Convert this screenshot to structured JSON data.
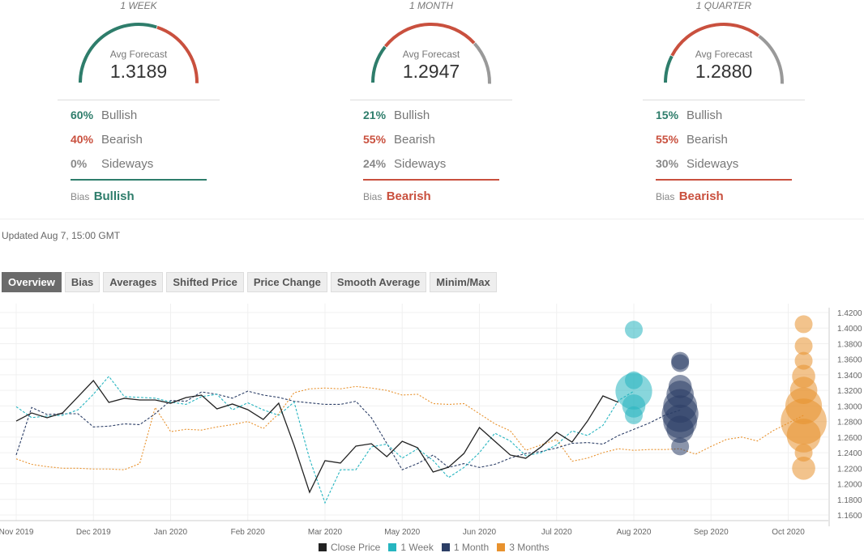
{
  "forecasts": [
    {
      "period": "1 WEEK",
      "avg_label": "Avg Forecast",
      "avg": "1.3189",
      "bullish": "60%",
      "bearish": "40%",
      "sideways": "0%",
      "bullish_pct": 60,
      "bearish_pct": 40,
      "sideways_pct": 0,
      "bias_label": "Bias",
      "bias": "Bullish",
      "bias_color": "#2e7d6b"
    },
    {
      "period": "1 MONTH",
      "avg_label": "Avg Forecast",
      "avg": "1.2947",
      "bullish": "21%",
      "bearish": "55%",
      "sideways": "24%",
      "bullish_pct": 21,
      "bearish_pct": 55,
      "sideways_pct": 24,
      "bias_label": "Bias",
      "bias": "Bearish",
      "bias_color": "#c9503e"
    },
    {
      "period": "1 QUARTER",
      "avg_label": "Avg Forecast",
      "avg": "1.2880",
      "bullish": "15%",
      "bearish": "55%",
      "sideways": "30%",
      "bullish_pct": 15,
      "bearish_pct": 55,
      "sideways_pct": 30,
      "bias_label": "Bias",
      "bias": "Bearish",
      "bias_color": "#c9503e"
    }
  ],
  "labels": {
    "bullish": "Bullish",
    "bearish": "Bearish",
    "sideways": "Sideways"
  },
  "colors": {
    "bullish": "#2e7d6b",
    "bearish": "#c9503e",
    "sideways": "#999999"
  },
  "updated": "Updated Aug 7, 15:00 GMT",
  "tabs": [
    "Overview",
    "Bias",
    "Averages",
    "Shifted Price",
    "Price Change",
    "Smooth Average",
    "Minim/Max"
  ],
  "active_tab": "Overview",
  "chart_data": {
    "type": "line",
    "ylim": [
      1.15,
      1.43
    ],
    "yticks": [
      "1.4200",
      "1.4000",
      "1.3800",
      "1.3600",
      "1.3400",
      "1.3200",
      "1.3000",
      "1.2800",
      "1.2600",
      "1.2400",
      "1.2200",
      "1.2000",
      "1.1800",
      "1.1600"
    ],
    "xticks": [
      {
        "i": 0,
        "label": "Nov 2019"
      },
      {
        "i": 5,
        "label": "Dec 2019"
      },
      {
        "i": 10,
        "label": "Jan 2020"
      },
      {
        "i": 15,
        "label": "Feb 2020"
      },
      {
        "i": 20,
        "label": "Mar 2020"
      },
      {
        "i": 25,
        "label": "May 2020"
      },
      {
        "i": 30,
        "label": "Jun 2020"
      },
      {
        "i": 35,
        "label": "Jul 2020"
      },
      {
        "i": 40,
        "label": "Aug 2020"
      },
      {
        "i": 45,
        "label": "Sep 2020"
      },
      {
        "i": 50,
        "label": "Oct 2020"
      }
    ],
    "grid": true,
    "legend_position": "bottom",
    "series": [
      {
        "name": "Close Price",
        "color": "#222222",
        "style": "solid",
        "values": [
          1.2806,
          1.291,
          1.2848,
          1.291,
          1.3118,
          1.3326,
          1.3046,
          1.3098,
          1.3077,
          1.3077,
          1.3035,
          1.3108,
          1.3139,
          1.2962,
          1.3025,
          1.2952,
          1.2827,
          1.3035,
          1.2494,
          1.1891,
          1.2297,
          1.2266,
          1.2484,
          1.2515,
          1.2349,
          1.2546,
          1.2463,
          1.2151,
          1.2213,
          1.239,
          1.2723,
          1.2546,
          1.237,
          1.2328,
          1.2474,
          1.2661,
          1.2536,
          1.2806,
          1.3129,
          1.3046
        ]
      },
      {
        "name": "1 Week",
        "color": "#26b5c0",
        "style": "dashed",
        "values": [
          1.299,
          1.285,
          1.287,
          1.288,
          1.295,
          1.315,
          1.338,
          1.312,
          1.311,
          1.31,
          1.305,
          1.302,
          1.312,
          1.315,
          1.295,
          1.304,
          1.295,
          1.288,
          1.305,
          1.232,
          1.1756,
          1.218,
          1.218,
          1.2474,
          1.251,
          1.233,
          1.245,
          1.23,
          1.208,
          1.221,
          1.24,
          1.265,
          1.255,
          1.236,
          1.24,
          1.25,
          1.268,
          1.262,
          1.275,
          1.307,
          1.3189
        ]
      },
      {
        "name": "1 Month",
        "color": "#2c3e66",
        "style": "dashed",
        "values": [
          1.237,
          1.298,
          1.289,
          1.29,
          1.29,
          1.273,
          1.274,
          1.277,
          1.276,
          1.29,
          1.307,
          1.306,
          1.318,
          1.315,
          1.31,
          1.319,
          1.314,
          1.311,
          1.306,
          1.304,
          1.302,
          1.302,
          1.306,
          1.285,
          1.252,
          1.218,
          1.226,
          1.237,
          1.221,
          1.226,
          1.221,
          1.225,
          1.233,
          1.239,
          1.2415,
          1.246,
          1.252,
          1.253,
          1.251,
          1.262,
          1.27,
          1.278,
          1.288,
          1.2947
        ]
      },
      {
        "name": "3 Months",
        "color": "#e8922e",
        "style": "dotted",
        "values": [
          1.232,
          1.225,
          1.222,
          1.22,
          1.22,
          1.219,
          1.219,
          1.218,
          1.226,
          1.298,
          1.267,
          1.27,
          1.269,
          1.273,
          1.276,
          1.28,
          1.271,
          1.29,
          1.317,
          1.322,
          1.323,
          1.322,
          1.325,
          1.323,
          1.32,
          1.314,
          1.315,
          1.303,
          1.302,
          1.303,
          1.29,
          1.277,
          1.268,
          1.243,
          1.25,
          1.257,
          1.229,
          1.233,
          1.24,
          1.245,
          1.243,
          1.244,
          1.244,
          1.245,
          1.238,
          1.248,
          1.257,
          1.26,
          1.255,
          1.268,
          1.278,
          1.288
        ]
      }
    ],
    "bubbles": [
      {
        "series": "1 Week",
        "i": 40,
        "color": "#26b5c0",
        "points": [
          [
            1.398,
            1
          ],
          [
            1.333,
            1
          ],
          [
            1.3189,
            6
          ],
          [
            1.3,
            2
          ],
          [
            1.288,
            1
          ]
        ]
      },
      {
        "series": "1 Month",
        "i": 43,
        "color": "#2c3e66",
        "points": [
          [
            1.358,
            1
          ],
          [
            1.355,
            1
          ],
          [
            1.325,
            2
          ],
          [
            1.315,
            3
          ],
          [
            1.3,
            5
          ],
          [
            1.29,
            6
          ],
          [
            1.28,
            5
          ],
          [
            1.27,
            3
          ],
          [
            1.248,
            1
          ]
        ]
      },
      {
        "series": "3 Months",
        "i": 51,
        "color": "#e8922e",
        "points": [
          [
            1.405,
            1
          ],
          [
            1.377,
            1
          ],
          [
            1.358,
            1
          ],
          [
            1.338,
            2
          ],
          [
            1.32,
            3
          ],
          [
            1.3,
            6
          ],
          [
            1.28,
            10
          ],
          [
            1.262,
            5
          ],
          [
            1.24,
            1
          ],
          [
            1.22,
            2
          ]
        ]
      }
    ]
  }
}
